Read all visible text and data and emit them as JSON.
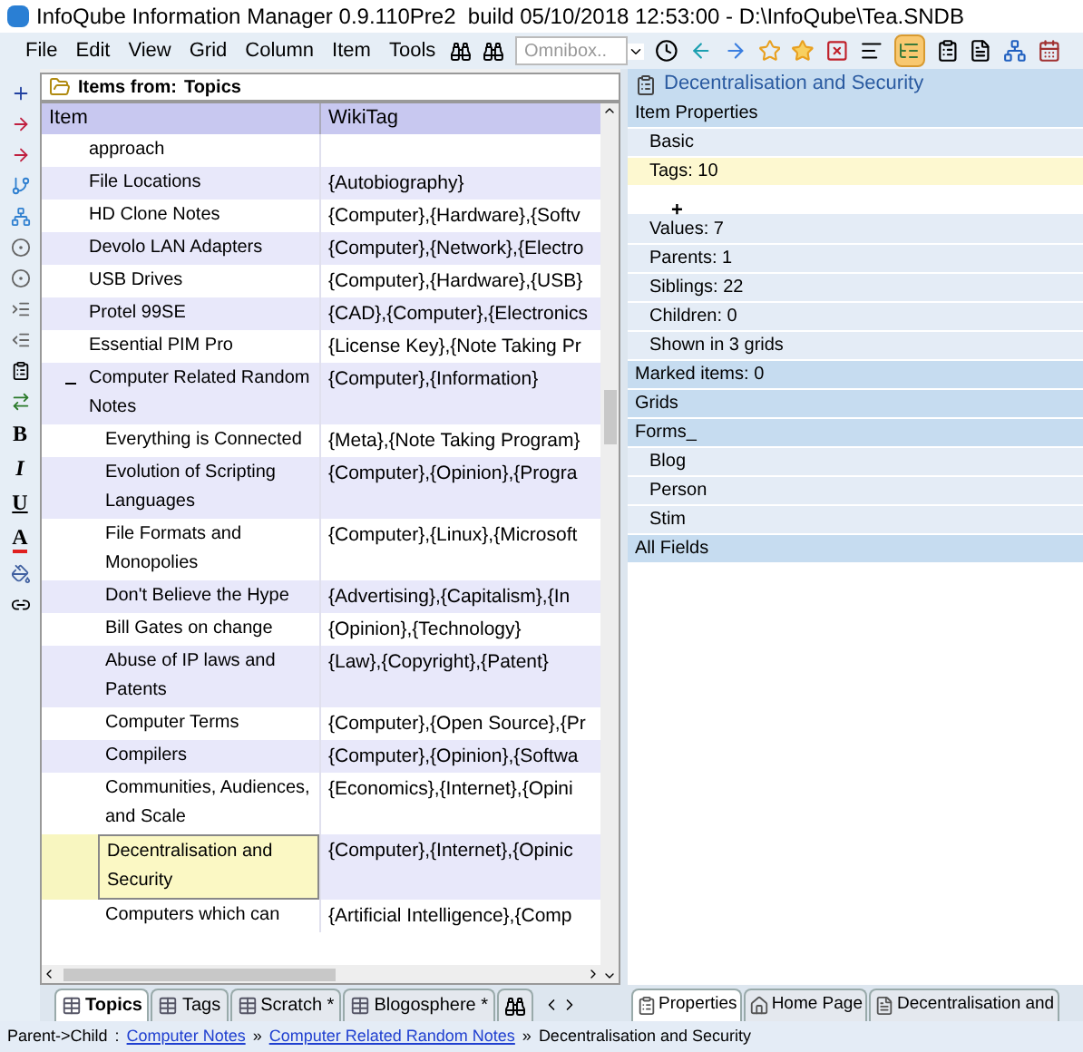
{
  "window": {
    "title": "InfoQube Information Manager 0.9.110Pre2  build 05/10/2018 12:53:00 - D:\\InfoQube\\Tea.SNDB"
  },
  "menu": [
    "File",
    "Edit",
    "View",
    "Grid",
    "Column",
    "Item",
    "Tools"
  ],
  "omnibox": {
    "placeholder": "Omnibox.."
  },
  "toolbar": {
    "outline_toggle": {
      "on": true
    }
  },
  "format_buttons": [
    "B",
    "I",
    "U",
    "A"
  ],
  "grid": {
    "source_label": "Items from:",
    "source": "Topics",
    "columns": [
      "Item",
      "WikiTag"
    ],
    "rows": [
      {
        "item": "approach",
        "selected": false
      },
      {
        "item": "File Locations",
        "wikitag": "{Autobiography}",
        "selected": false
      },
      {
        "item": "HD Clone Notes",
        "wikitag": "{Computer},{Hardware},{Softv",
        "selected": false
      },
      {
        "item": "Devolo LAN Adapters",
        "wikitag": "{Computer},{Network},{Electro",
        "selected": false
      },
      {
        "item": "USB Drives",
        "wikitag": "{Computer},{Hardware},{USB}",
        "selected": false
      },
      {
        "item": "Protel 99SE",
        "wikitag": "{CAD},{Computer},{Electronics",
        "selected": false
      },
      {
        "item": "Essential PIM Pro",
        "wikitag": "{License Key},{Note Taking Pr",
        "selected": false
      },
      {
        "item": "Computer Related Random Notes",
        "wikitag": "{Computer},{Information}",
        "selected": false,
        "expanded": true,
        "children": [
          {
            "item": "Everything is Connected",
            "wikitag": "{Meta},{Note Taking Program}",
            "selected": false
          },
          {
            "item": "Evolution of Scripting Languages",
            "wikitag": "{Computer},{Opinion},{Progra",
            "selected": false
          },
          {
            "item": "File Formats and Monopolies",
            "wikitag": "{Computer},{Linux},{Microsoft",
            "selected": false
          },
          {
            "item": "Don't Believe the Hype",
            "wikitag": "{Advertising},{Capitalism},{In",
            "selected": false
          },
          {
            "item": "Bill Gates on change",
            "wikitag": "{Opinion},{Technology}",
            "selected": false
          },
          {
            "item": "Abuse of IP laws and Patents",
            "wikitag": "{Law},{Copyright},{Patent}",
            "selected": false
          },
          {
            "item": "Computer Terms",
            "wikitag": "{Computer},{Open Source},{Pr",
            "selected": false
          },
          {
            "item": "Compilers",
            "wikitag": "{Computer},{Opinion},{Softwa",
            "selected": false
          },
          {
            "item": "Communities, Audiences, and Scale",
            "wikitag": "{Economics},{Internet},{Opini",
            "selected": false
          },
          {
            "item": "Decentralisation and Security",
            "wikitag": "{Computer},{Internet},{Opinic",
            "selected": true
          },
          {
            "item": "Computers which can",
            "wikitag": "{Artificial Intelligence},{Comp",
            "selected": false
          }
        ]
      }
    ]
  },
  "grid_tabs": [
    {
      "kind": "grid",
      "label": "Topics",
      "selected": true
    },
    {
      "kind": "grid",
      "label": "Tags",
      "selected": false
    },
    {
      "kind": "grid",
      "label": "Scratch *",
      "selected": false
    },
    {
      "kind": "grid",
      "label": "Blogosphere *",
      "selected": false
    },
    {
      "kind": "search",
      "selected": false
    }
  ],
  "properties": {
    "title": "Decentralisation and Security",
    "rows": [
      {
        "kind": "section",
        "label": "Item Properties",
        "selected": false
      },
      {
        "kind": "item",
        "label": "Basic",
        "selected": false
      },
      {
        "kind": "item",
        "label": "Tags: 10",
        "selected": true
      },
      {
        "kind": "add",
        "label": "+",
        "selected": false
      },
      {
        "kind": "item",
        "label": "Values: 7",
        "selected": false
      },
      {
        "kind": "item",
        "label": "Parents: 1",
        "selected": false
      },
      {
        "kind": "item",
        "label": "Siblings: 22",
        "selected": false
      },
      {
        "kind": "item",
        "label": "Children: 0",
        "selected": false
      },
      {
        "kind": "item",
        "label": "Shown in 3 grids",
        "selected": false
      },
      {
        "kind": "section",
        "label": "Marked items: 0",
        "selected": false
      },
      {
        "kind": "section",
        "label": "Grids",
        "selected": false
      },
      {
        "kind": "section",
        "label": "Forms_",
        "selected": false
      },
      {
        "kind": "item",
        "label": "Blog",
        "selected": false
      },
      {
        "kind": "item",
        "label": "Person",
        "selected": false
      },
      {
        "kind": "item",
        "label": "Stim",
        "selected": false
      },
      {
        "kind": "section",
        "label": "All Fields",
        "selected": false
      }
    ]
  },
  "panel_tabs": [
    {
      "kind": "properties",
      "label": "Properties",
      "selected": true
    },
    {
      "kind": "home",
      "label": "Home Page",
      "selected": false
    },
    {
      "kind": "document",
      "label": "Decentralisation and",
      "selected": false
    }
  ],
  "status_bar": {
    "label": "Parent->Child",
    "separator": ":",
    "path": [
      {
        "kind": "link",
        "text": "Computer Notes",
        "divider": "»"
      },
      {
        "kind": "link",
        "text": "Computer Related Random Notes",
        "divider": "»"
      },
      {
        "kind": "current",
        "text": "Decentralisation and Security"
      }
    ]
  }
}
